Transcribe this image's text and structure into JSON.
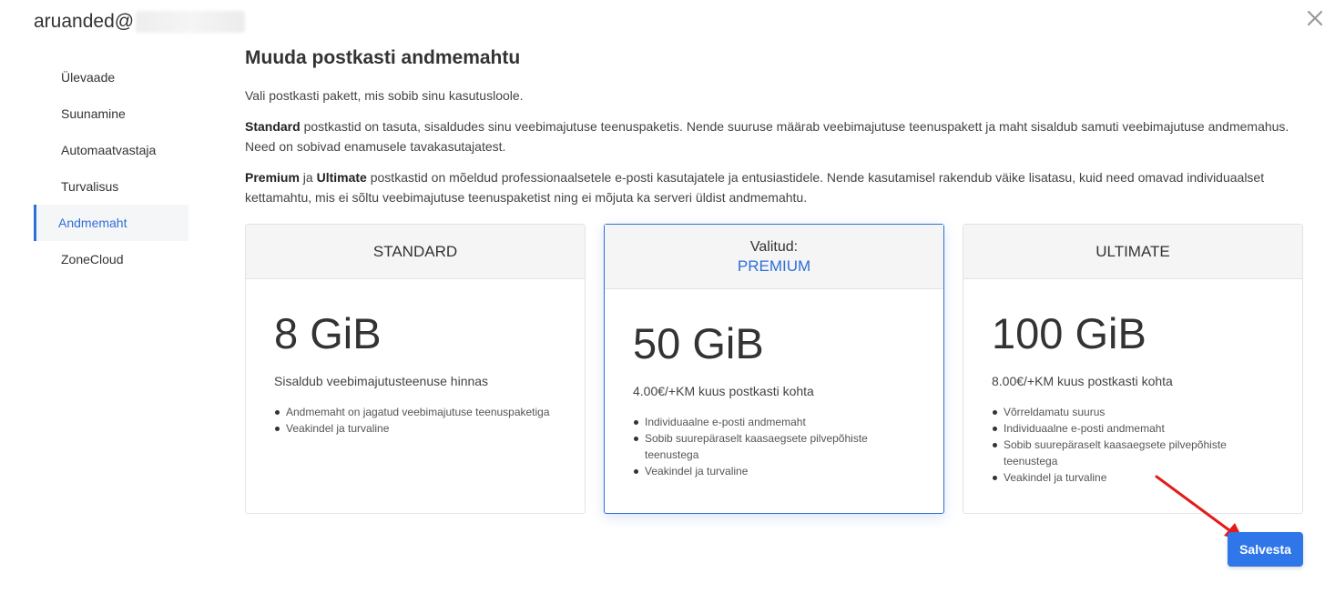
{
  "account": {
    "title": "aruanded@"
  },
  "icons": {
    "close": "close-icon",
    "arrow": "red-arrow-annotation"
  },
  "colors": {
    "accent": "#2f6fd6",
    "button": "#2f76e8",
    "annotation": "#e51b1b"
  },
  "sidebar": {
    "items": [
      {
        "label": "Ülevaade",
        "active": false
      },
      {
        "label": "Suunamine",
        "active": false
      },
      {
        "label": "Automaatvastaja",
        "active": false
      },
      {
        "label": "Turvalisus",
        "active": false
      },
      {
        "label": "Andmemaht",
        "active": true
      },
      {
        "label": "ZoneCloud",
        "active": false
      }
    ]
  },
  "main": {
    "title": "Muuda postkasti andmemahtu",
    "intro": "Vali postkasti pakett, mis sobib sinu kasutusloole.",
    "p2": {
      "strong": "Standard",
      "text": " postkastid on tasuta, sisaldudes sinu veebimajutuse teenuspaketis. Nende suuruse määrab veebimajutuse teenuspakett ja maht sisaldub samuti veebimajutuse andmemahus. Need on sobivad enamusele tavakasutajatest."
    },
    "p3": {
      "strong1": "Premium",
      "mid": " ja ",
      "strong2": "Ultimate",
      "text": " postkastid on mõeldud professionaalsetele e-posti kasutajatele ja entusiastidele. Nende kasutamisel rakendub väike lisatasu, kuid need omavad individuaalset kettamahtu, mis ei sõltu veebimajutuse teenuspaketist ning ei mõjuta ka serveri üldist andmemahtu."
    }
  },
  "plans": [
    {
      "name": "STANDARD",
      "size": "8 GiB",
      "price": "Sisaldub veebimajutusteenuse hinnas",
      "features": [
        "Andmemaht on jagatud veebimajutuse teenuspaketiga",
        "Veakindel ja turvaline"
      ]
    },
    {
      "selected_label": "Valitud:",
      "name": "PREMIUM",
      "size": "50 GiB",
      "price": "4.00€/+KM kuus postkasti kohta",
      "features": [
        "Individuaalne e-posti andmemaht",
        "Sobib suurepäraselt kaasaegsete pilvepõhiste teenustega",
        "Veakindel ja turvaline"
      ]
    },
    {
      "name": "ULTIMATE",
      "size": "100 GiB",
      "price": "8.00€/+KM kuus postkasti kohta",
      "features": [
        "Võrreldamatu suurus",
        "Individuaalne e-posti andmemaht",
        "Sobib suurepäraselt kaasaegsete pilvepõhiste teenustega",
        "Veakindel ja turvaline"
      ]
    }
  ],
  "actions": {
    "save_label": "Salvesta"
  }
}
